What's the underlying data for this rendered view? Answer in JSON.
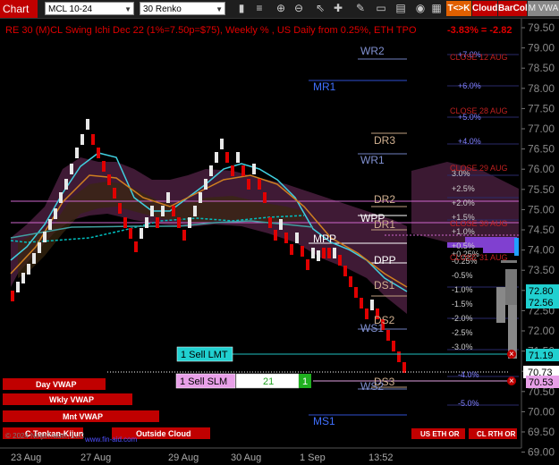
{
  "toolbar": {
    "title": "Chart",
    "instrument": "MCL 10-24",
    "bar_type": "30 Renko",
    "btn_tk": "T<>K",
    "btn_cloud": "Cloud",
    "btn_barcol": "BarCol",
    "btn_vwap": "M VWA"
  },
  "chart": {
    "header": "RE 30 (M)CL Swing Ichi Dec 22  (1%=7.50p=$75), Weekly % , US Daily from 0.25%, ETH TPO",
    "change": "-3.83% = -2.82",
    "watermark": "© 2024 NinjaTrader, LLC",
    "site": "www.fin-aid.com",
    "price_labels": [
      "79.50",
      "79.00",
      "78.50",
      "78.00",
      "77.50",
      "77.00",
      "76.50",
      "76.00",
      "75.50",
      "75.00",
      "74.50",
      "74.00",
      "73.50",
      "73.00",
      "72.50",
      "72.00",
      "71.50",
      "71.00",
      "70.50",
      "70.00",
      "69.50",
      "69.00"
    ],
    "date_labels": [
      "23 Aug",
      "27 Aug",
      "29 Aug",
      "30 Aug",
      "1 Sep",
      "13:52"
    ],
    "pct_labels": [
      "+7.0%",
      "+6.0%",
      "+5.0%",
      "+4.0%",
      "3.0%",
      "+2.5%",
      "+2.0%",
      "+1.5%",
      "+1.0%",
      "+0.5%",
      "+0.25%",
      "-0.25%",
      "-0.5%",
      "-1.0%",
      "-1.5%",
      "-2.0%",
      "-2.5%",
      "-3.0%",
      "-4.0%",
      "-5.0%"
    ],
    "close_labels": [
      "CLOSE 12 AUG",
      "CLOSE 28 AUG",
      "CLOSE 29 AUG",
      "CLOSE 30 AUG",
      "CLOSE 31 AUG"
    ],
    "pivot_labels": [
      "WR2",
      "MR1",
      "DR3",
      "WR1",
      "DR2",
      "WPP",
      "DR1",
      "MPP",
      "DPP",
      "DS1",
      "DS2",
      "WS1",
      "DS3",
      "WS2",
      "MS1"
    ],
    "price_tags": {
      "p1": "72.80",
      "p2": "72.56",
      "p3": "71.19",
      "p4": "70.73",
      "p5": "70.53"
    },
    "orders": {
      "sell_lmt": "1 Sell LMT",
      "sell_slm": "1 Sell SLM",
      "qty": "21",
      "one": "1"
    },
    "vwap_buttons": [
      "Day VWAP",
      "Wkly VWAP",
      "Mnt VWAP",
      "C Tenkan-Kijun",
      "Outside Cloud"
    ],
    "session_buttons": [
      "US ETH OR",
      "CL RTH OR"
    ],
    "colors": {
      "up": "#e8e8e8",
      "down": "#e00000",
      "background": "#000000",
      "cloud": "#5a2a55",
      "accent": "#c00000"
    }
  }
}
